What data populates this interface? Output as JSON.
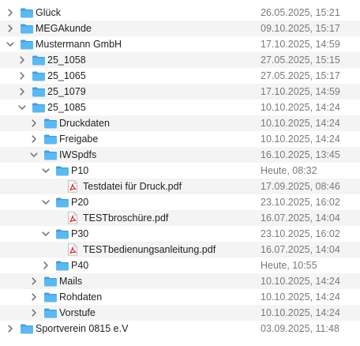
{
  "rows": [
    {
      "name": "Glück",
      "date": "26.05.2025, 15:21",
      "depth": 0,
      "kind": "folder",
      "expanded": false,
      "icon": "folder-icon"
    },
    {
      "name": "MEGAkunde",
      "date": "09.10.2025, 15:17",
      "depth": 0,
      "kind": "folder",
      "expanded": false,
      "icon": "folder-icon"
    },
    {
      "name": "Mustermann GmbH",
      "date": "17.10.2025, 14:59",
      "depth": 0,
      "kind": "folder",
      "expanded": true,
      "icon": "folder-icon"
    },
    {
      "name": "25_1058",
      "date": "27.05.2025, 15:15",
      "depth": 1,
      "kind": "folder",
      "expanded": false,
      "icon": "folder-icon"
    },
    {
      "name": "25_1065",
      "date": "27.05.2025, 15:17",
      "depth": 1,
      "kind": "folder",
      "expanded": false,
      "icon": "folder-icon"
    },
    {
      "name": "25_1079",
      "date": "17.10.2025, 14:59",
      "depth": 1,
      "kind": "folder",
      "expanded": false,
      "icon": "folder-icon"
    },
    {
      "name": "25_1085",
      "date": "10.10.2025, 14:24",
      "depth": 1,
      "kind": "folder",
      "expanded": true,
      "icon": "folder-icon"
    },
    {
      "name": "Druckdaten",
      "date": "10.10.2025, 14:24",
      "depth": 2,
      "kind": "folder",
      "expanded": false,
      "icon": "folder-icon"
    },
    {
      "name": "Freigabe",
      "date": "10.10.2025, 14:24",
      "depth": 2,
      "kind": "folder",
      "expanded": false,
      "icon": "folder-icon"
    },
    {
      "name": "IWSpdfs",
      "date": "16.10.2025, 13:45",
      "depth": 2,
      "kind": "folder",
      "expanded": true,
      "icon": "folder-icon"
    },
    {
      "name": "P10",
      "date": "Heute, 08:32",
      "depth": 3,
      "kind": "folder",
      "expanded": true,
      "icon": "folder-icon"
    },
    {
      "name": "Testdatei für Druck.pdf",
      "date": "17.09.2025, 08:46",
      "depth": 4,
      "kind": "pdf",
      "expanded": false,
      "icon": "pdf-file-icon"
    },
    {
      "name": "P20",
      "date": "23.10.2025, 16:02",
      "depth": 3,
      "kind": "folder",
      "expanded": true,
      "icon": "folder-icon"
    },
    {
      "name": "TESTbroschüre.pdf",
      "date": "16.07.2025, 14:04",
      "depth": 4,
      "kind": "pdf",
      "expanded": false,
      "icon": "pdf-file-icon"
    },
    {
      "name": "P30",
      "date": "23.10.2025, 16:02",
      "depth": 3,
      "kind": "folder",
      "expanded": true,
      "icon": "folder-icon"
    },
    {
      "name": "TESTbedienungsanleitung.pdf",
      "date": "16.07.2025, 14:04",
      "depth": 4,
      "kind": "pdf",
      "expanded": false,
      "icon": "pdf-file-icon"
    },
    {
      "name": "P40",
      "date": "Heute, 10:55",
      "depth": 3,
      "kind": "folder",
      "expanded": false,
      "icon": "folder-icon"
    },
    {
      "name": "Mails",
      "date": "10.10.2025, 14:24",
      "depth": 2,
      "kind": "folder",
      "expanded": false,
      "icon": "folder-icon"
    },
    {
      "name": "Rohdaten",
      "date": "10.10.2025, 14:24",
      "depth": 2,
      "kind": "folder",
      "expanded": false,
      "icon": "folder-icon"
    },
    {
      "name": "Vorstufe",
      "date": "10.10.2025, 14:24",
      "depth": 2,
      "kind": "folder",
      "expanded": false,
      "icon": "folder-icon"
    },
    {
      "name": "Sportverein 0815 e.V",
      "date": "03.09.2025, 11:48",
      "depth": 0,
      "kind": "folder",
      "expanded": false,
      "icon": "folder-icon"
    }
  ],
  "colors": {
    "folder_body": "#5db8f0",
    "folder_tab": "#3e9fe0",
    "pdf_red": "#e0352b",
    "date_text": "#7a7a7a",
    "stripe": "#f4f4f5",
    "chevron": "#6e6e6e"
  }
}
